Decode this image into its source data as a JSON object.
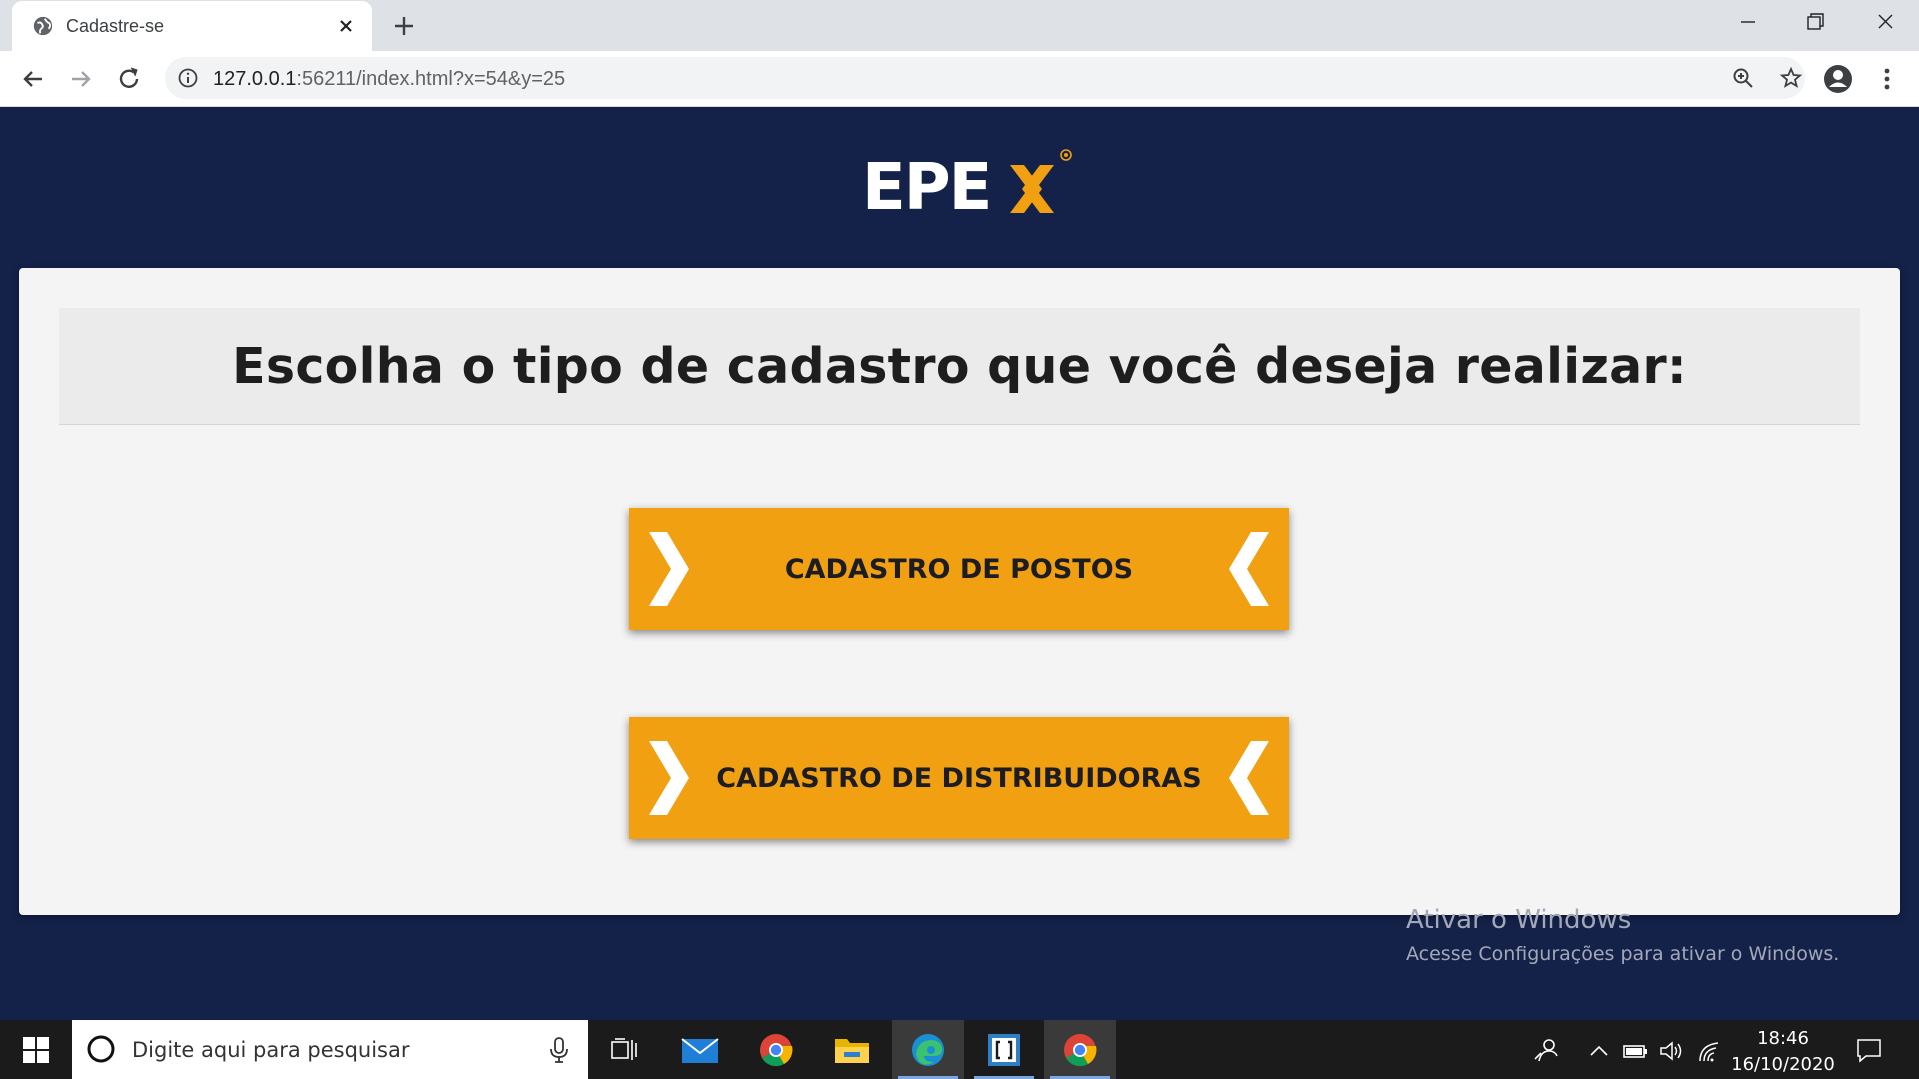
{
  "browser": {
    "tab_title": "Cadastre-se",
    "url_host": "127.0.0.1",
    "url_rest": ":56211/index.html?x=54&y=25"
  },
  "page": {
    "logo_text": "EPEX",
    "heading": "Escolha o tipo de cadastro que você deseja realizar:",
    "options": [
      {
        "label": "CADASTRO DE POSTOS"
      },
      {
        "label": "CADASTRO DE DISTRIBUIDORAS"
      }
    ],
    "colors": {
      "background": "#14224a",
      "accent": "#f0a010",
      "card": "#f4f4f4"
    }
  },
  "watermark": {
    "title": "Ativar o Windows",
    "subtitle": "Acesse Configurações para ativar o Windows."
  },
  "taskbar": {
    "search_placeholder": "Digite aqui para pesquisar",
    "time": "18:46",
    "date": "16/10/2020",
    "apps": [
      "task-view-icon",
      "mail-icon",
      "chrome-icon",
      "file-explorer-icon",
      "edge-icon",
      "bracket-app-icon",
      "chrome-icon"
    ]
  }
}
